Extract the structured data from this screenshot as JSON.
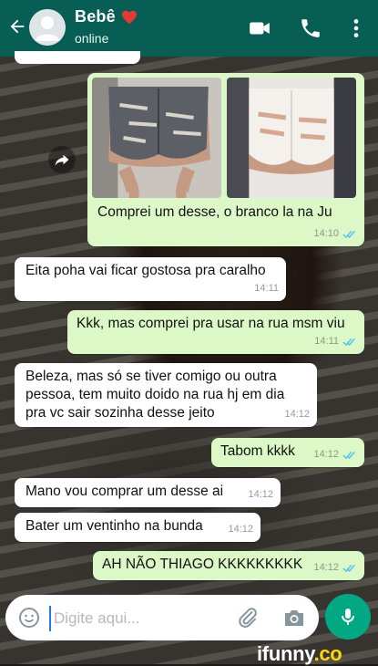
{
  "header": {
    "contact_name": "Bebê",
    "status": "online",
    "icons": [
      "back-arrow-icon",
      "avatar",
      "heart-icon",
      "video-call-icon",
      "phone-call-icon",
      "more-menu-icon"
    ]
  },
  "messages": [
    {
      "id": 0,
      "direction": "out",
      "type": "image",
      "images": [
        "denim-shorts-photo",
        "white-shorts-photo"
      ],
      "caption": "Comprei um desse, o branco la na Ju",
      "time": "14:10",
      "read": true
    },
    {
      "id": 1,
      "direction": "in",
      "text": "Eita poha vai ficar gostosa pra caralho",
      "time": "14:11"
    },
    {
      "id": 2,
      "direction": "out",
      "text": "Kkk, mas comprei pra usar na rua msm viu",
      "time": "14:11",
      "read": true
    },
    {
      "id": 3,
      "direction": "in",
      "text": "Beleza, mas só se tiver comigo ou outra pessoa, tem muito doido na rua hj em dia pra vc sair sozinha desse jeito",
      "time": "14:12"
    },
    {
      "id": 4,
      "direction": "out",
      "text": "Tabom kkkk",
      "time": "14:12",
      "read": true
    },
    {
      "id": 5,
      "direction": "in",
      "text": "Mano vou comprar um desse ai",
      "time": "14:12"
    },
    {
      "id": 6,
      "direction": "in",
      "text": "Bater um ventinho na bunda",
      "time": "14:12"
    },
    {
      "id": 7,
      "direction": "out",
      "text": "AH NÃO THIAGO KKKKKKKKK",
      "time": "14:12",
      "read": true
    }
  ],
  "composer": {
    "placeholder": "Digite aqui...",
    "icons": [
      "emoji-icon",
      "attach-icon",
      "camera-icon",
      "mic-icon"
    ]
  },
  "watermark": {
    "brand": "ifunny",
    "suffix": ".co"
  },
  "colors": {
    "header": "#075e54",
    "outgoing": "#dcf8c6",
    "incoming": "#ffffff",
    "read_ticks": "#4fc3f7",
    "mic": "#00a884"
  }
}
